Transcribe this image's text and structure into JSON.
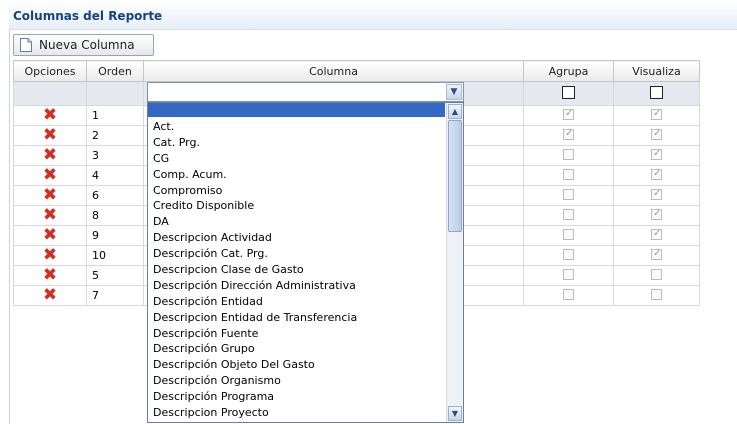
{
  "panel": {
    "title": "Columnas del Reporte"
  },
  "toolbar": {
    "new_column_label": "Nueva Columna"
  },
  "table": {
    "headers": {
      "opciones": "Opciones",
      "orden": "Orden",
      "columna": "Columna",
      "agrupa": "Agrupa",
      "visualiza": "Visualiza"
    },
    "rows": [
      {
        "orden": "1",
        "agrupa": true,
        "visualiza": true
      },
      {
        "orden": "2",
        "agrupa": true,
        "visualiza": true
      },
      {
        "orden": "3",
        "agrupa": false,
        "visualiza": true
      },
      {
        "orden": "4",
        "agrupa": false,
        "visualiza": true
      },
      {
        "orden": "6",
        "agrupa": false,
        "visualiza": true
      },
      {
        "orden": "8",
        "agrupa": false,
        "visualiza": true
      },
      {
        "orden": "9",
        "agrupa": false,
        "visualiza": true
      },
      {
        "orden": "10",
        "agrupa": false,
        "visualiza": true
      },
      {
        "orden": "5",
        "agrupa": false,
        "visualiza": false
      },
      {
        "orden": "7",
        "agrupa": false,
        "visualiza": false
      }
    ]
  },
  "dropdown": {
    "options": [
      "Act.",
      "Cat. Prg.",
      "CG",
      "Comp. Acum.",
      "Compromiso",
      "Credito Disponible",
      "DA",
      "Descripcion Actividad",
      "Descripción Cat. Prg.",
      "Descripcion Clase de Gasto",
      "Descripción Dirección Administrativa",
      "Descripción Entidad",
      "Descripcion Entidad de Transferencia",
      "Descripción Fuente",
      "Descripción Grupo",
      "Descripción Objeto Del Gasto",
      "Descripción Organismo",
      "Descripción Programa",
      "Descripcion Proyecto"
    ]
  },
  "icons": {
    "delete": "delete-x-icon",
    "new": "new-document-icon",
    "dropdown": "chevron-down-icon"
  },
  "colors": {
    "title": "#15428b",
    "delete": "#d32f20",
    "highlight": "#3368c4"
  }
}
